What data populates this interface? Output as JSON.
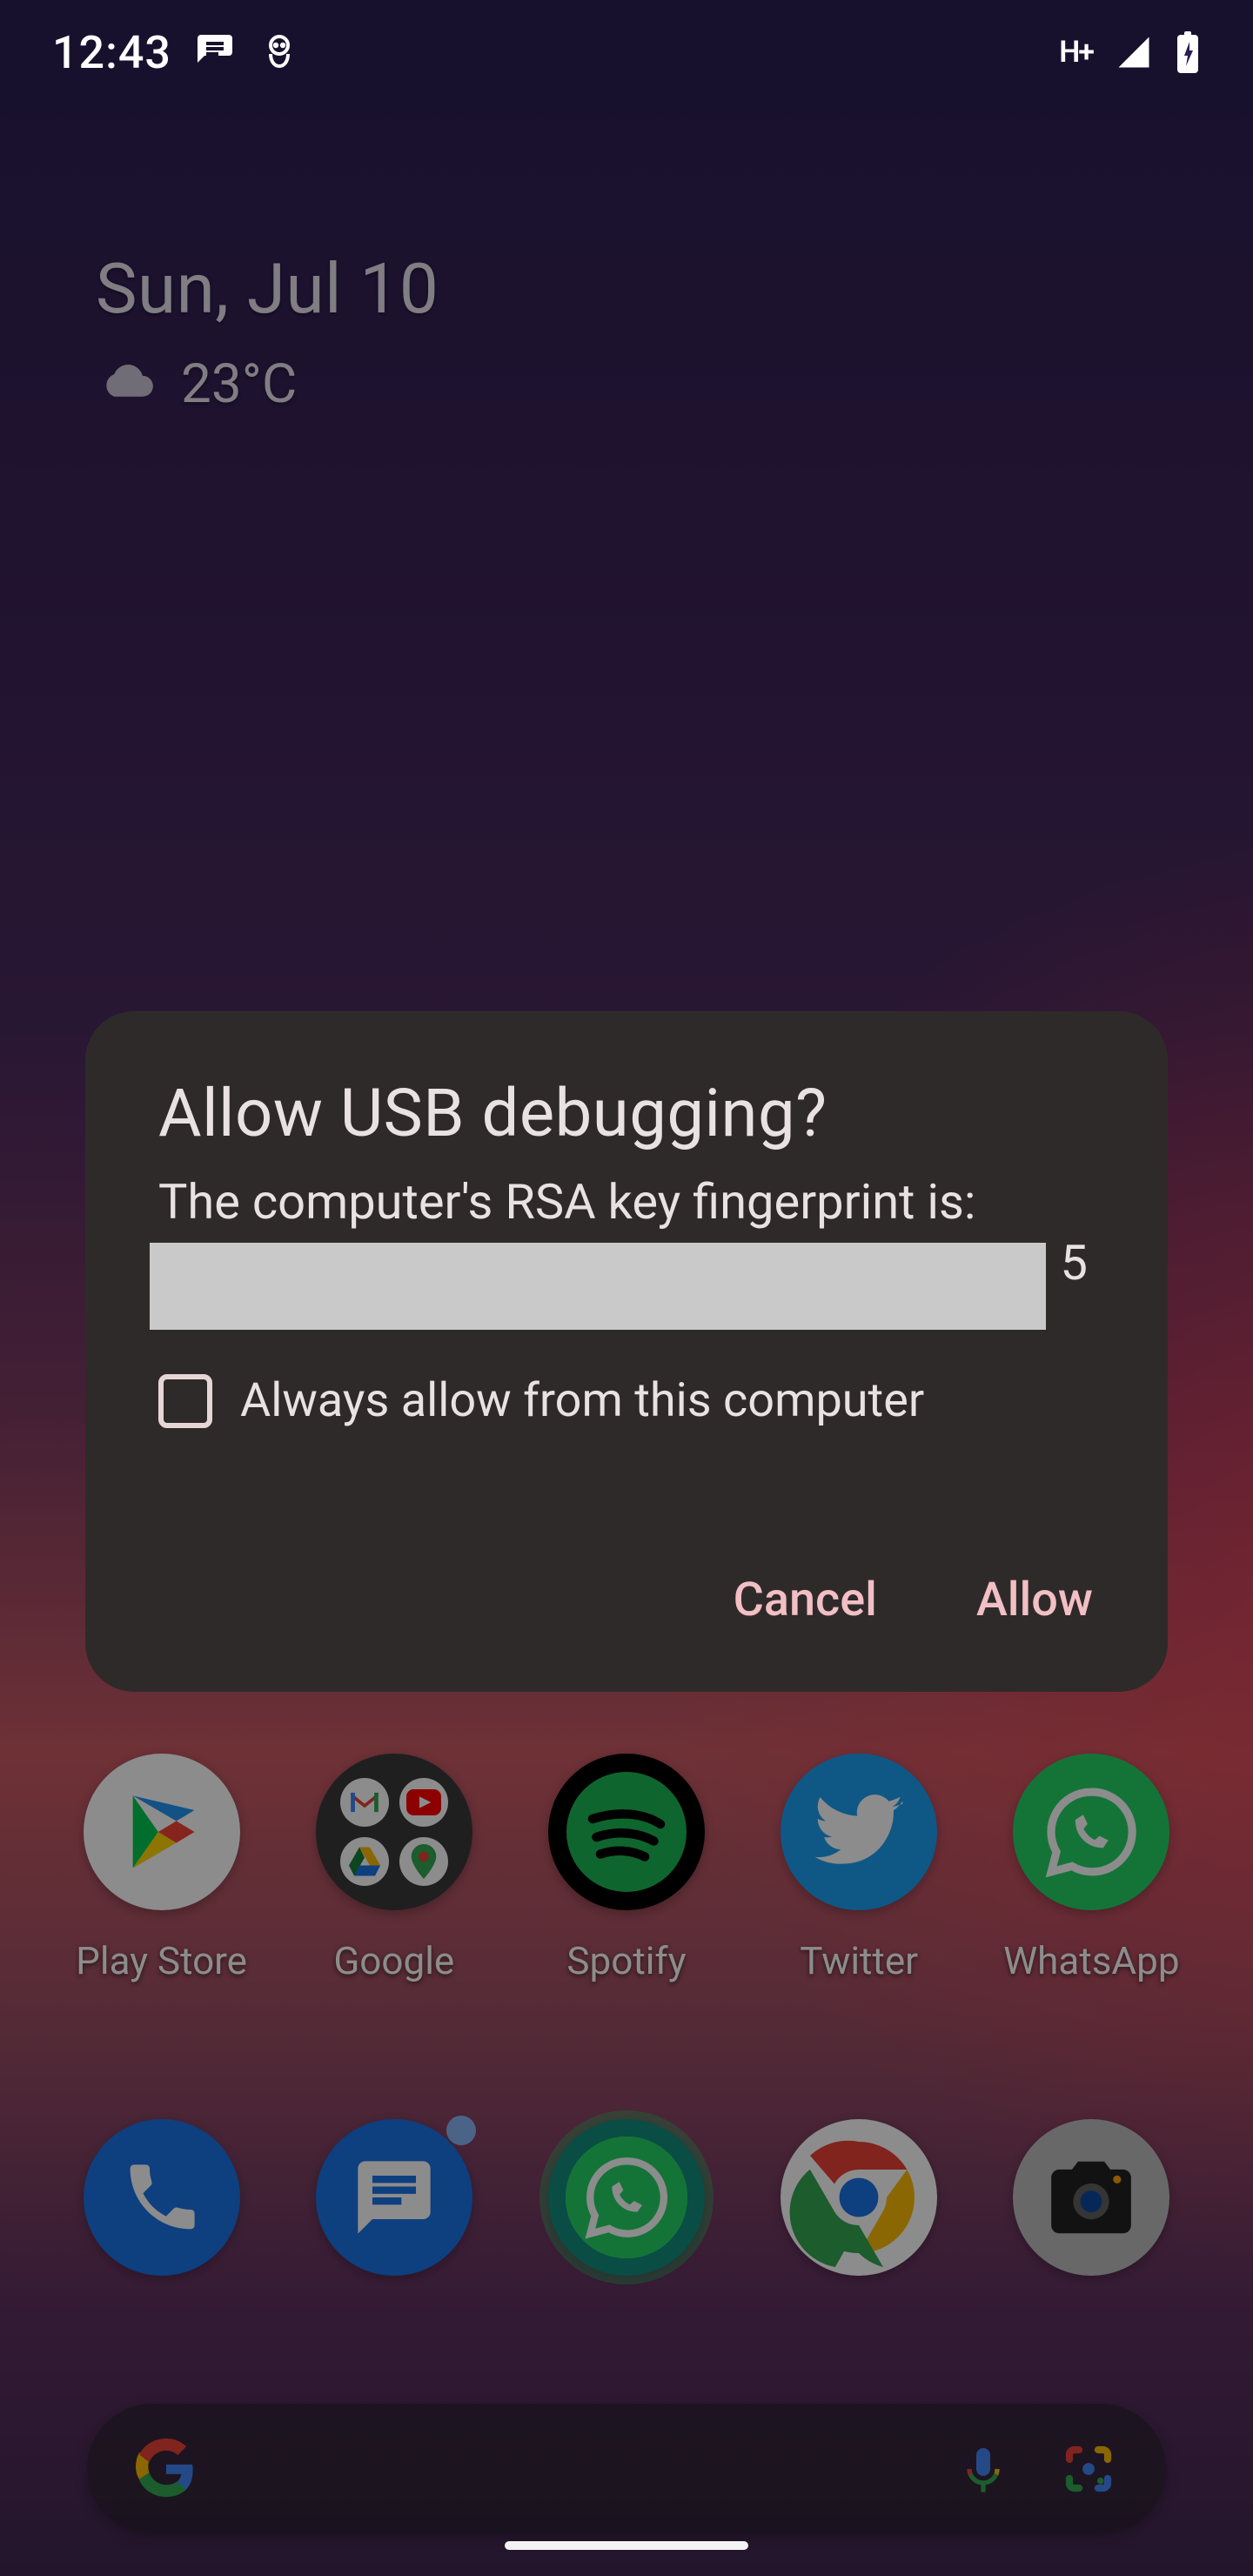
{
  "status": {
    "time": "12:43",
    "network_label": "H+"
  },
  "widget": {
    "date": "Sun, Jul 10",
    "temp": "23°C"
  },
  "apps": {
    "play_store": "Play Store",
    "google": "Google",
    "spotify": "Spotify",
    "twitter": "Twitter",
    "whatsapp": "WhatsApp"
  },
  "dialog": {
    "title": "Allow USB debugging?",
    "subtitle": "The computer's RSA key fingerprint is:",
    "fingerprint_tail": "5",
    "always_label": "Always allow from this computer",
    "buttons": {
      "cancel": "Cancel",
      "allow": "Allow"
    }
  }
}
